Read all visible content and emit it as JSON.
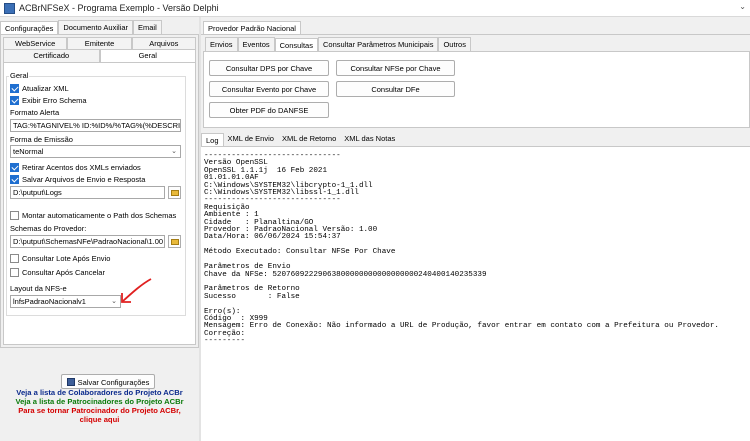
{
  "window": {
    "title": "ACBrNFSeX - Programa Exemplo - Versão Delphi"
  },
  "left": {
    "tabs": [
      "Configurações",
      "Documento Auxiliar",
      "Email"
    ],
    "subtabs_row1": [
      "WebService",
      "Emitente",
      "Arquivos"
    ],
    "subtabs_row2": [
      "Certificado",
      "Geral"
    ],
    "group_title": "Geral",
    "atualizar_xml": "Atualizar XML",
    "exibir_erro": "Exibir Erro Schema",
    "formato_alerta_label": "Formato Alerta",
    "formato_alerta_value": "TAG:%TAGNIVEL% ID:%ID%/%TAG%(%DESCRI",
    "forma_emissao_label": "Forma de Emissão",
    "forma_emissao_value": "teNormal",
    "retirar_acentos": "Retirar Acentos dos XMLs enviados",
    "salvar_arquivos": "Salvar Arquivos de Envio e Resposta",
    "path_logs": "D:\\putput\\Logs",
    "montar_path": "Montar automaticamente o Path dos Schemas",
    "schemas_label": "Schemas do Provedor:",
    "schemas_value": "D:\\putput\\SchemasNFe\\PadraoNacional\\1.00",
    "consultar_lote": "Consultar Lote Após Envio",
    "consultar_cancelar": "Consultar Após Cancelar",
    "layout_label": "Layout da NFS-e",
    "layout_value": "lnfsPadraoNacionalv1",
    "salvar_btn": "Salvar Configurações",
    "link1": "Veja a lista de Colaboradores do Projeto ACBr",
    "link2": "Veja a lista de Patrocinadores do Projeto ACBr",
    "link3a": "Para se tornar Patrocinador do Projeto ACBr,",
    "link3b": "clique aqui",
    "link1_color": "#0b2a8c",
    "link2_color": "#0a7a0a",
    "link3_color": "#d40000"
  },
  "right": {
    "top_tab": "Provedor Padrão Nacional",
    "tabs": [
      "Envios",
      "Eventos",
      "Consultas",
      "Consultar Parâmetros Municipais",
      "Outros"
    ],
    "buttons": {
      "dps": "Consultar DPS por Chave",
      "nfse": "Consultar NFSe por Chave",
      "evento": "Consultar Evento por Chave",
      "dfe": "Consultar DFe",
      "pdf": "Obter PDF do DANFSE"
    },
    "log_tabs": [
      "Log",
      "XML de Envio",
      "XML de Retorno",
      "XML das Notas"
    ],
    "log_text": "------------------------------\nVersão OpenSSL\nOpenSSL 1.1.1j  16 Feb 2021\n01.01.01.0AF\nC:\\Windows\\SYSTEM32\\libcrypto-1_1.dll\nC:\\Windows\\SYSTEM32\\libssl-1_1.dll\n------------------------------\nRequisição\nAmbiente : 1\nCidade   : Planaltina/GO\nProvedor : PadraoNacional Versão: 1.00\nData/Hora: 06/06/2024 15:54:37\n\nMétodo Executado: Consultar NFSe Por Chave\n\nParâmetros de Envio\nChave da NFSe: 52076092229063800000000000000000240400140235339\n\nParâmetros de Retorno\nSucesso       : False\n\nErro(s):\nCódigo  : X999\nMensagem: Erro de Conexão: Não informado a URL de Produção, favor entrar em contato com a Prefeitura ou Provedor.\nCorreção:\n---------"
  },
  "icons": [
    "app-icon",
    "chevron-down-icon",
    "folder-icon",
    "save-icon",
    "arrow-annotation-icon"
  ]
}
